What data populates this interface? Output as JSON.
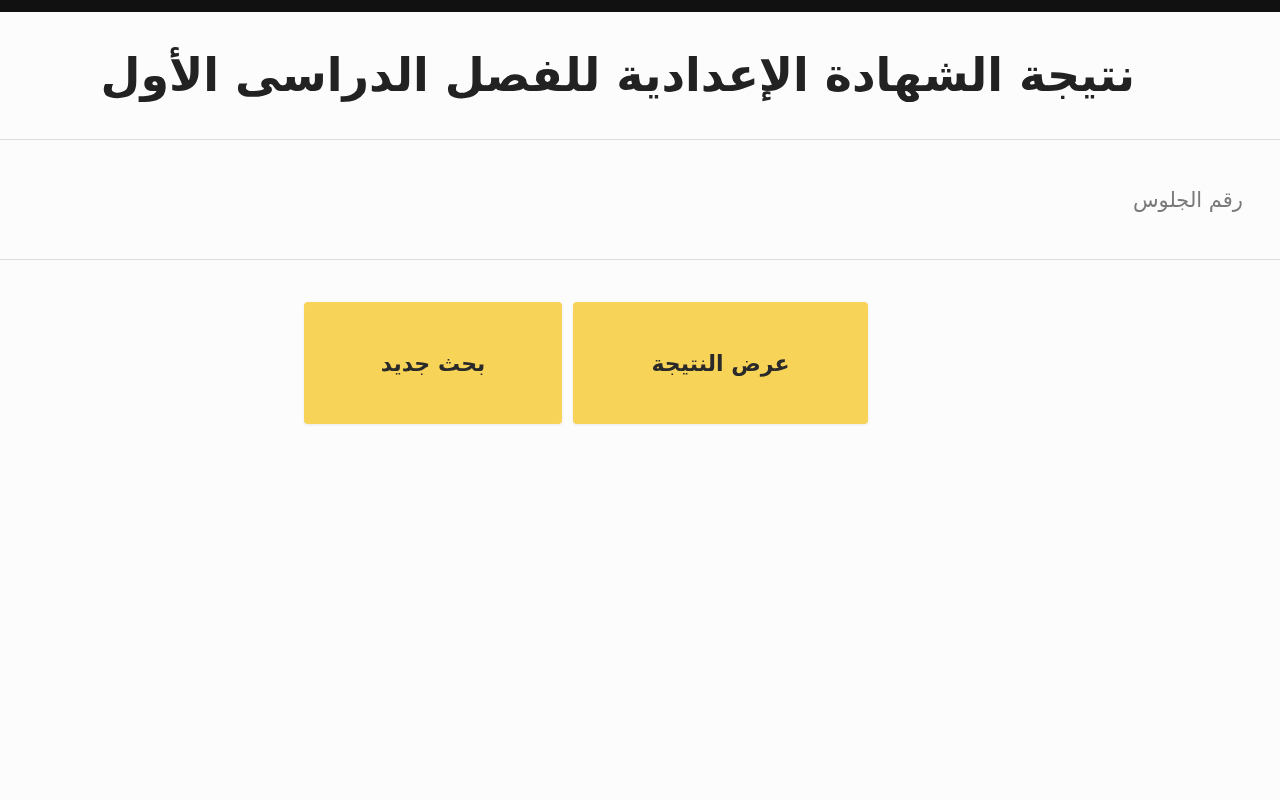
{
  "page": {
    "title": "نتيجة الشهادة الإعدادية للفصل الدراسى الأول"
  },
  "form": {
    "seat_number_field": {
      "placeholder": "رقم الجلوس"
    },
    "buttons": [
      {
        "label": "عرض النتيجة"
      },
      {
        "label": "بحث جديد"
      }
    ]
  }
}
